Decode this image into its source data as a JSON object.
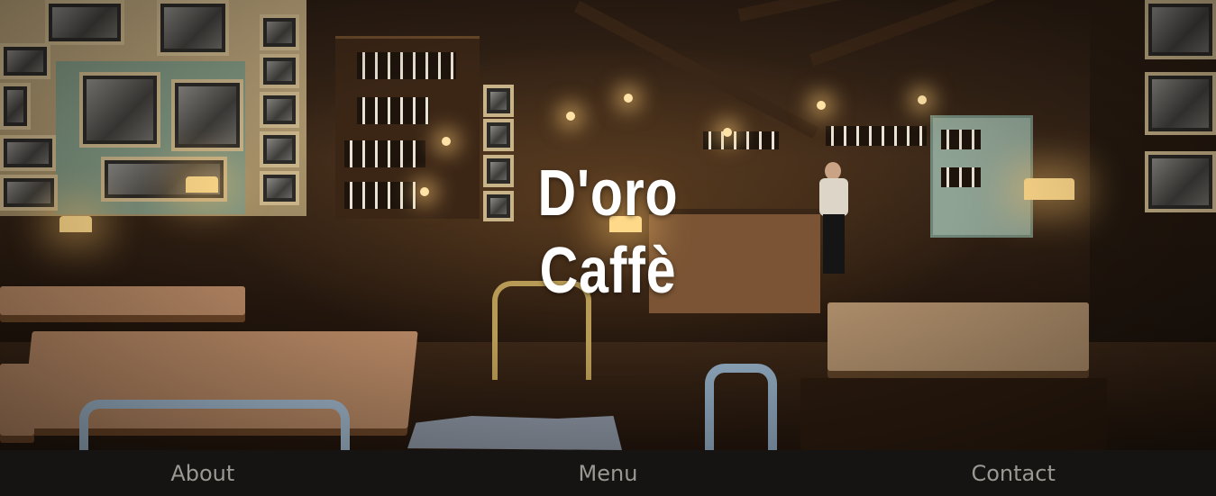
{
  "hero": {
    "title_line1": "D'oro",
    "title_line2": "Caffè"
  },
  "nav": {
    "items": [
      {
        "label": "About"
      },
      {
        "label": "Menu"
      },
      {
        "label": "Contact"
      }
    ]
  },
  "colors": {
    "nav_background": "#161412",
    "nav_text": "#9b9792",
    "title_text": "#ffffff"
  }
}
